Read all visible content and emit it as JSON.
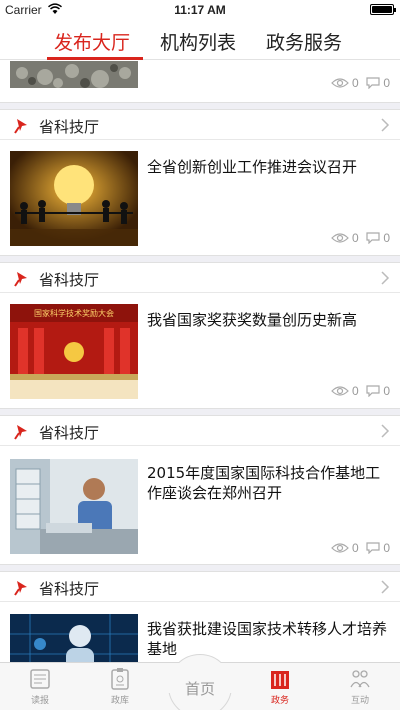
{
  "status_bar": {
    "carrier": "Carrier",
    "time": "11:17 AM"
  },
  "tabs": [
    {
      "label": "发布大厅",
      "active": true
    },
    {
      "label": "机构列表",
      "active": false
    },
    {
      "label": "政务服务",
      "active": false
    }
  ],
  "first_stats": {
    "views": "0",
    "comments": "0"
  },
  "news": [
    {
      "source": "省科技厅",
      "title": "全省创新创业工作推进会议召开",
      "views": "0",
      "comments": "0",
      "image": "lightbulb-with-people"
    },
    {
      "source": "省科技厅",
      "title": "我省国家奖获奖数量创历史新高",
      "views": "0",
      "comments": "0",
      "image": "award-ceremony-stage",
      "image_caption": "国家科学技术奖励大会"
    },
    {
      "source": "省科技厅",
      "title": "2015年度国家国际科技合作基地工作座谈会在郑州召开",
      "views": "0",
      "comments": "0",
      "image": "technician-in-lab"
    },
    {
      "source": "省科技厅",
      "title": "我省获批建设国家技术转移人才培养基地",
      "views": "",
      "comments": "",
      "image": "digital-human-figure"
    }
  ],
  "bottom_nav": [
    {
      "label": "读报",
      "icon": "newspaper-icon",
      "active": false
    },
    {
      "label": "政库",
      "icon": "clipboard-icon",
      "active": false
    },
    {
      "label": "首页",
      "icon": "home",
      "active": false
    },
    {
      "label": "政务",
      "icon": "government-icon",
      "active": true
    },
    {
      "label": "互动",
      "icon": "people-icon",
      "active": false
    }
  ],
  "colors": {
    "accent": "#d9251d",
    "muted": "#999999",
    "background": "#efeff4"
  }
}
